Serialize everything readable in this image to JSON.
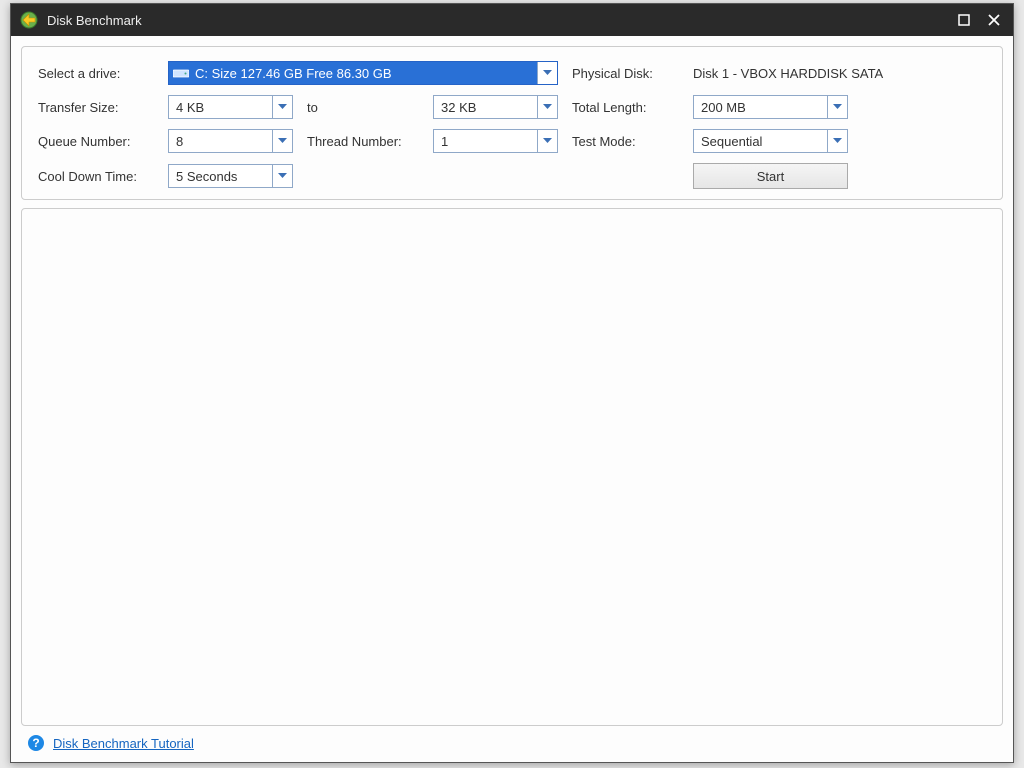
{
  "window": {
    "title": "Disk Benchmark"
  },
  "settings": {
    "drive_label": "Select a drive:",
    "drive_value": "C:  Size 127.46 GB  Free 86.30 GB",
    "physical_disk_label": "Physical Disk:",
    "physical_disk_value": "Disk 1 - VBOX HARDDISK SATA",
    "transfer_size_label": "Transfer Size:",
    "transfer_size_from": "4 KB",
    "transfer_to_label": "to",
    "transfer_size_to": "32 KB",
    "total_length_label": "Total Length:",
    "total_length_value": "200 MB",
    "queue_number_label": "Queue Number:",
    "queue_number_value": "8",
    "thread_number_label": "Thread Number:",
    "thread_number_value": "1",
    "test_mode_label": "Test Mode:",
    "test_mode_value": "Sequential",
    "cooldown_label": "Cool Down Time:",
    "cooldown_value": "5 Seconds",
    "start_label": "Start"
  },
  "footer": {
    "tutorial_link": "Disk Benchmark Tutorial"
  }
}
